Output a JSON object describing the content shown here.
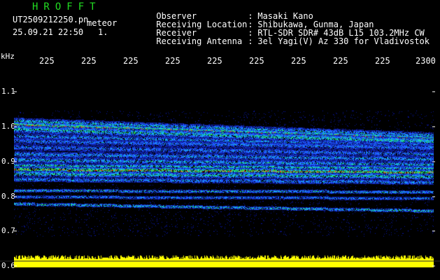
{
  "header": {
    "app_title": "HROFFT",
    "filename": "UT2509212250.pn",
    "mode": "meteor",
    "datetime": "25.09.21 22:50",
    "frame": "1.",
    "info": [
      {
        "label": "Observer",
        "value": "Masaki Kano"
      },
      {
        "label": "Receiving Location",
        "value": "Shibukawa, Gunma, Japan"
      },
      {
        "label": "Receiver",
        "value": "RTL-SDR SDR# 43dB L15 103.2MHz CW"
      },
      {
        "label": "Receiving Antenna",
        "value": "3el Yagi(V) Az 330 for Vladivostok"
      }
    ],
    "separator": ":"
  },
  "axis": {
    "unit": "kHz",
    "time_ticks": [
      "225",
      "225",
      "225",
      "225",
      "225",
      "225",
      "225",
      "225",
      "225",
      "2300"
    ],
    "freq_ticks": [
      "1.1",
      "1.0",
      "0.9",
      "0.8",
      "0.7",
      "0.6"
    ]
  },
  "colors": {
    "background": "#000000",
    "title": "#22dd22",
    "text": "#ffffff",
    "signal_strong": "#ff3030",
    "signal_mid": "#22ff44",
    "signal_low": "#1e5aff",
    "level_bar": "#ffff00"
  }
}
